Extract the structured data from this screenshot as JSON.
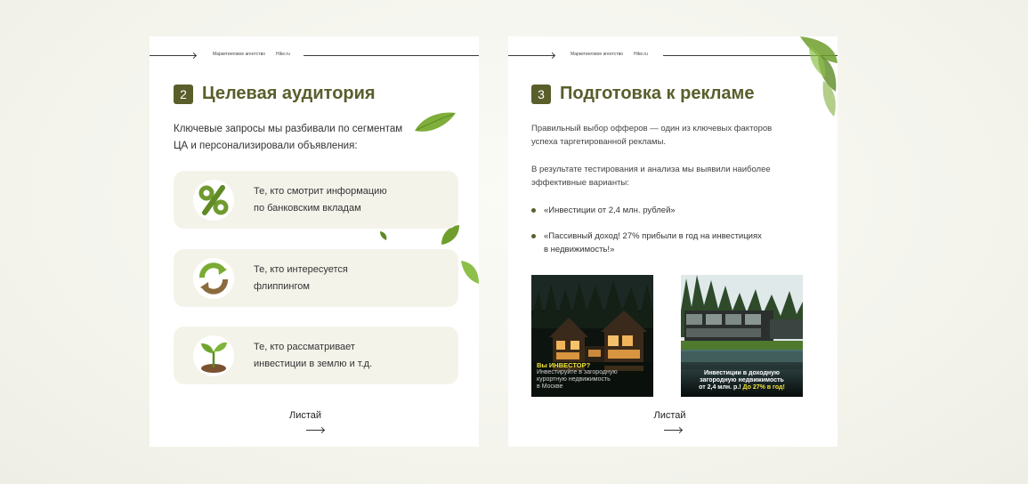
{
  "slide1": {
    "header": {
      "agency": "Маркетинговое агентство",
      "site": "Hike.ru"
    },
    "number": "2",
    "title": "Целевая аудитория",
    "intro": [
      "Ключевые запросы мы разбивали по сегментам",
      "ЦА и персонализировали объявления:"
    ],
    "cards": [
      {
        "icon": "percent-icon",
        "lines": [
          "Те, кто смотрит информацию",
          "по банковским вкладам"
        ]
      },
      {
        "icon": "recycle-arrows-icon",
        "lines": [
          "Те, кто интересуется",
          "флиппингом"
        ]
      },
      {
        "icon": "sprout-icon",
        "lines": [
          "Те, кто рассматривает",
          "инвестиции в землю и т.д."
        ]
      }
    ],
    "more_label": "Листай"
  },
  "slide2": {
    "header": {
      "agency": "Маркетинговое агентство",
      "site": "Hike.ru"
    },
    "number": "3",
    "title": "Подготовка к рекламе",
    "para1": [
      "Правильный выбор офферов — один из ключевых факторов",
      "успеха таргетированной рекламы."
    ],
    "para2": [
      "В результате тестирования и анализа мы выявили наиболее",
      "эффективные варианты:"
    ],
    "bullets": [
      {
        "lines": [
          "«Инвестиции от 2,4 млн. рублей»"
        ]
      },
      {
        "lines": [
          "«Пассивный доход! 27% прибыли в год на инвестициях",
          "в недвижимость!»"
        ]
      }
    ],
    "ads": [
      {
        "headline": "Вы ИНВЕСТОР?",
        "lines": [
          "Инвестируйте в загородную",
          "курортную недвижимость",
          "в Москве"
        ]
      },
      {
        "lines": [
          "Инвестиции в доходную",
          "загородную недвижимость"
        ],
        "last_prefix": "от 2,4 млн. р.!",
        "last_highlight": " До 27% в год!"
      }
    ],
    "more_label": "Листай"
  },
  "colors": {
    "accent": "#5a5e2b",
    "card_bg": "#f4f3ea",
    "highlight": "#f1e33a"
  }
}
